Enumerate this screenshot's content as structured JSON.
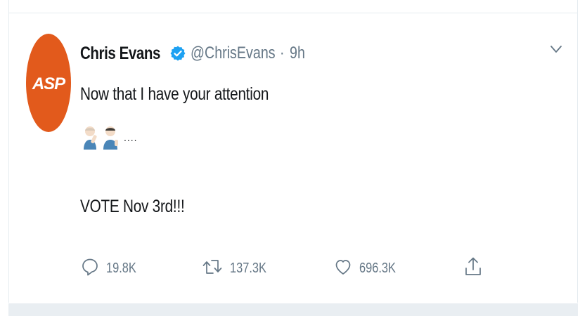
{
  "tweet": {
    "author": {
      "display_name": "Chris Evans",
      "handle": "@ChrisEvans",
      "verified": true,
      "avatar_text": "ASP"
    },
    "separator": "·",
    "timestamp": "9h",
    "text_line1": "Now that I have your attention",
    "emoji_trailing": "....",
    "text_line2": "VOTE Nov 3rd!!!",
    "actions": {
      "reply_count": "19.8K",
      "retweet_count": "137.3K",
      "like_count": "696.3K"
    },
    "icons": [
      "verified-badge-icon",
      "chevron-down-icon",
      "reply-icon",
      "retweet-icon",
      "like-icon",
      "share-icon"
    ]
  },
  "colors": {
    "avatar_bg": "#e25a1c",
    "verified": "#1da1f2",
    "secondary_text": "#657786",
    "primary_text": "#14171a",
    "border": "#e6ecf0"
  }
}
